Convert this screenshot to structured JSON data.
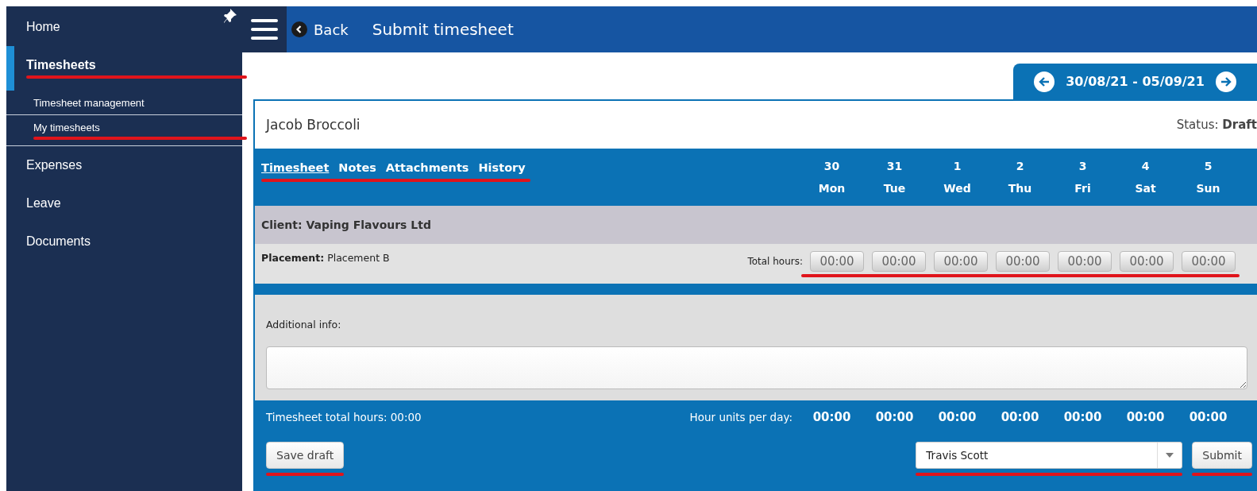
{
  "sidebar": {
    "items": [
      {
        "label": "Home",
        "selected": false,
        "underlined": false
      },
      {
        "label": "Timesheets",
        "selected": true,
        "underlined": true,
        "children": [
          {
            "label": "Timesheet management",
            "selected": false,
            "underlined": false
          },
          {
            "label": "My timesheets",
            "selected": true,
            "underlined": true
          }
        ]
      },
      {
        "label": "Expenses",
        "selected": false,
        "underlined": false
      },
      {
        "label": "Leave",
        "selected": false,
        "underlined": false
      },
      {
        "label": "Documents",
        "selected": false,
        "underlined": false
      }
    ]
  },
  "topbar": {
    "back": "Back",
    "title": "Submit timesheet"
  },
  "date_range": {
    "label": "30/08/21 - 05/09/21"
  },
  "employee": {
    "name": "Jacob Broccoli",
    "status_label": "Status:",
    "status": "Draft"
  },
  "tab_bar": {
    "underlined": true,
    "tabs": [
      {
        "label": "Timesheet",
        "selected": true
      },
      {
        "label": "Notes",
        "selected": false
      },
      {
        "label": "Attachments",
        "selected": false
      },
      {
        "label": "History",
        "selected": false
      }
    ]
  },
  "days": [
    {
      "date": "30",
      "day": "Mon"
    },
    {
      "date": "31",
      "day": "Tue"
    },
    {
      "date": "1",
      "day": "Wed"
    },
    {
      "date": "2",
      "day": "Thu"
    },
    {
      "date": "3",
      "day": "Fri"
    },
    {
      "date": "4",
      "day": "Sat"
    },
    {
      "date": "5",
      "day": "Sun"
    }
  ],
  "client": "Client: Vaping Flavours Ltd",
  "placement": {
    "label": "Placement:",
    "value": "Placement B"
  },
  "total_hours": {
    "label": "Total hours:",
    "underlined": true,
    "values": [
      "00:00",
      "00:00",
      "00:00",
      "00:00",
      "00:00",
      "00:00",
      "00:00"
    ]
  },
  "additional_info": {
    "label": "Additional info:"
  },
  "footer": {
    "total": "Timesheet total hours: 00:00",
    "per_day_label": "Hour units per day:",
    "per_day": [
      "00:00",
      "00:00",
      "00:00",
      "00:00",
      "00:00",
      "00:00",
      "00:00"
    ],
    "save": {
      "label": "Save draft",
      "underlined": true
    },
    "approver": {
      "value": "Travis Scott",
      "underlined": true
    },
    "submit": {
      "label": "Submit",
      "underlined": true
    }
  }
}
